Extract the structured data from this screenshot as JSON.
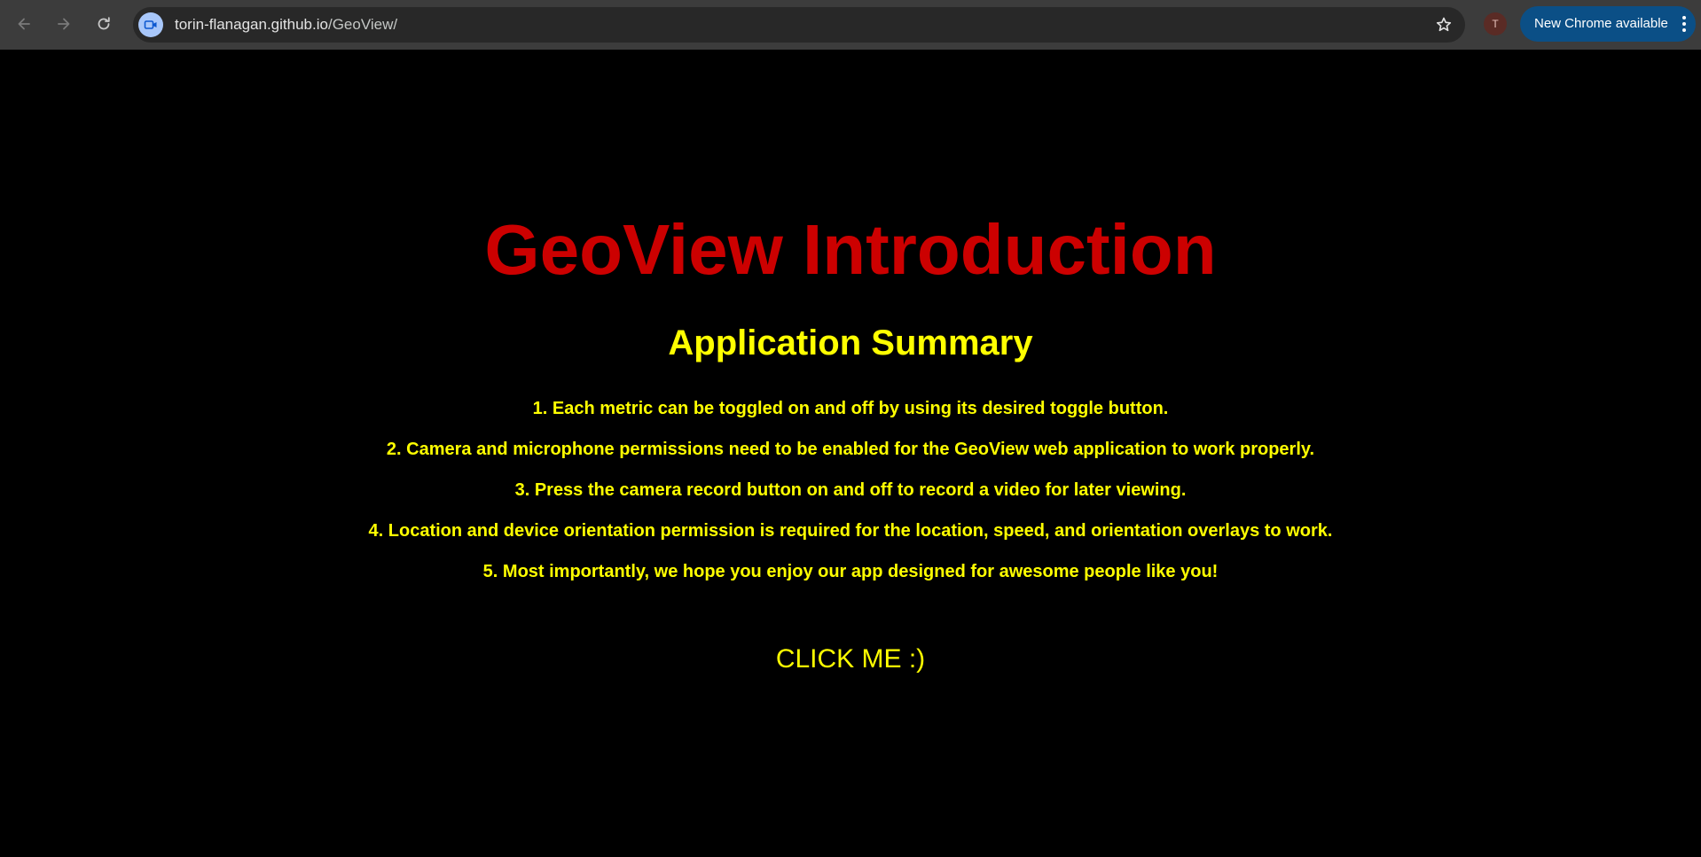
{
  "browser": {
    "url_host": "torin-flanagan.github.io",
    "url_path": "/GeoView/",
    "profile_initial": "T",
    "update_chip_label": "New Chrome available",
    "icons": [
      "back-arrow-icon",
      "forward-arrow-icon",
      "reload-icon",
      "site-camera-icon",
      "star-icon",
      "kebab-menu-icon"
    ]
  },
  "page": {
    "title": "GeoView Introduction",
    "subtitle": "Application Summary",
    "items": [
      "1. Each metric can be toggled on and off by using its desired toggle button.",
      "2. Camera and microphone permissions need to be enabled for the GeoView web application to work properly.",
      "3. Press the camera record button on and off to record a video for later viewing.",
      "4. Location and device orientation permission is required for the location, speed, and orientation overlays to work.",
      "5. Most importantly, we hope you enjoy our app designed for awesome people like you!"
    ],
    "cta_label": "CLICK ME :)"
  },
  "colors": {
    "background": "#000000",
    "title": "#cc0000",
    "text": "#ffff00",
    "toolbar": "#3c3c3c",
    "omnibox": "#282828",
    "update_chip": "#0b4f86"
  }
}
